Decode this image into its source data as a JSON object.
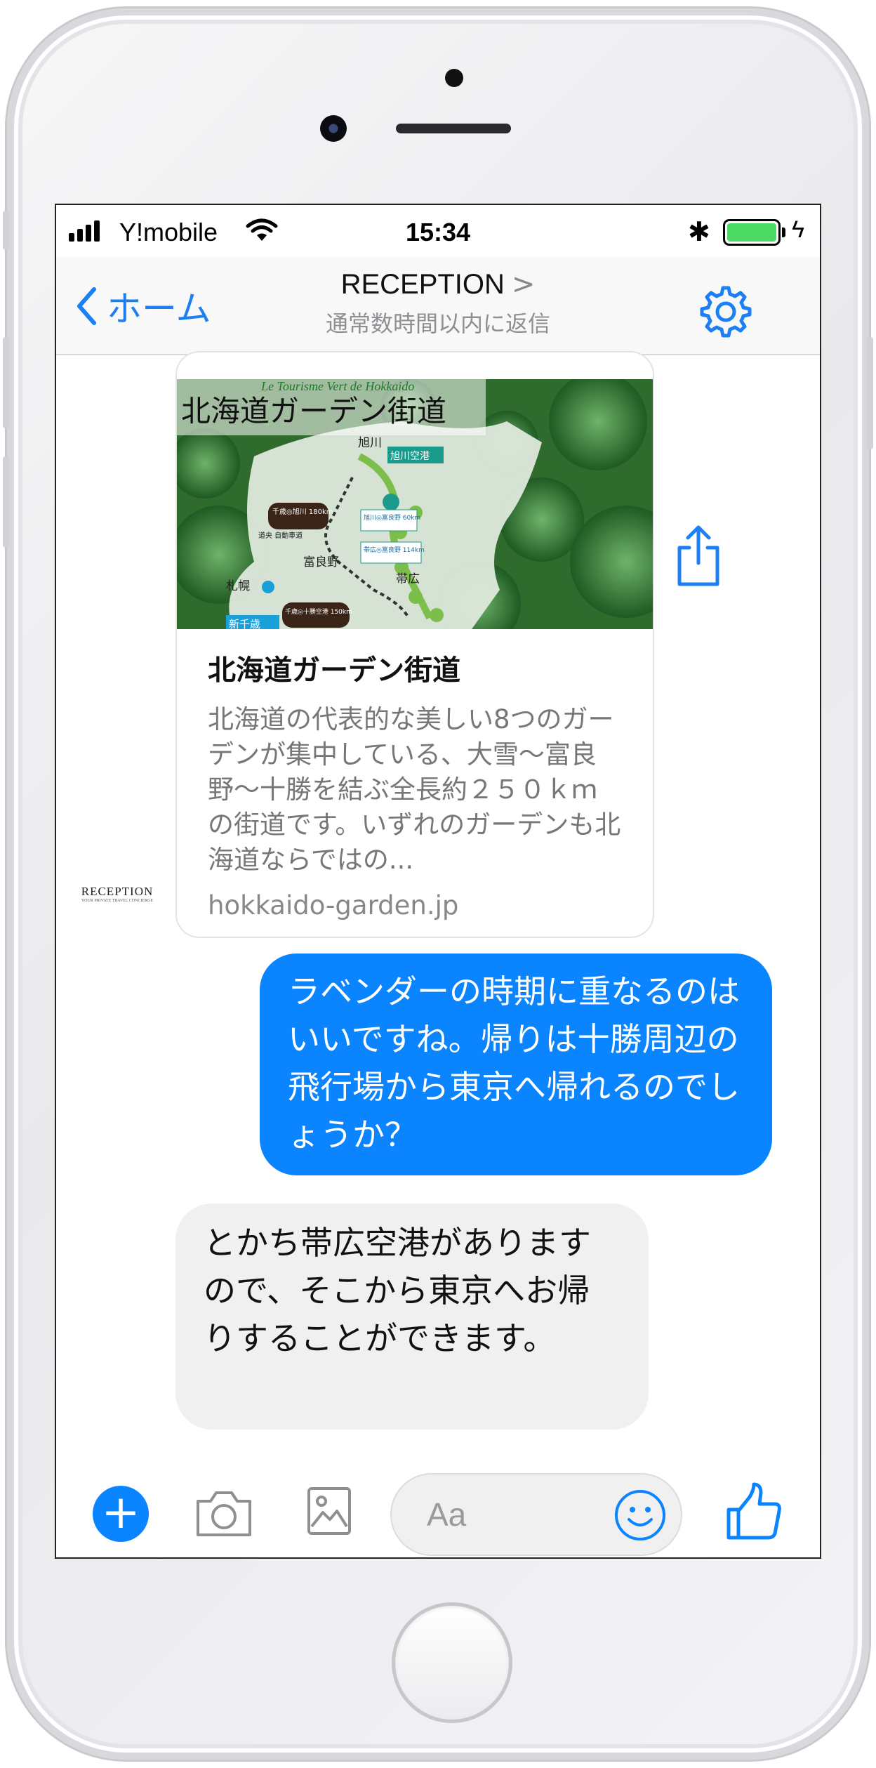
{
  "status": {
    "carrier": "Y!mobile",
    "time": "15:34",
    "bluetooth": "bluetooth-icon",
    "battery_level": 1.0
  },
  "nav": {
    "back_label": "ホーム",
    "title": "RECEPTION",
    "chevron": ">",
    "subtitle": "通常数時間以内に返信"
  },
  "link_preview": {
    "image_title": "北海道ガーデン街道",
    "image_tagline": "Le Tourisme Vert de Hokkaido",
    "map_labels": [
      "旭川",
      "旭川空港",
      "千歳◎旭川 180km",
      "道央 自動車道",
      "札幌",
      "富良野",
      "帯広",
      "新千歳",
      "千歳◎十勝空港 150km",
      "帯広◎富良野 114km",
      "旭川◎富良野 60km"
    ],
    "title": "北海道ガーデン街道",
    "description": "北海道の代表的な美しい8つのガーデンが集中している、大雪〜富良野〜十勝を結ぶ全長約２５０ｋｍの街道です。いずれのガーデンも北海道ならではの...",
    "domain": "hokkaido-garden.jp"
  },
  "sender_logo": {
    "name": "RECEPTION",
    "tagline": "YOUR PRIVATE TRAVEL CONCIERGE"
  },
  "messages": {
    "outgoing": "ラベンダーの時期に重なるのはいいですね。帰りは十勝周辺の飛行場から東京へ帰れるのでしょうか？",
    "incoming": "とかち帯広空港がありますので、そこから東京へお帰りすることができます。"
  },
  "composer": {
    "placeholder": "Aa"
  },
  "colors": {
    "accent": "#0a84ff",
    "link": "#1c7ff4",
    "incoming_bubble": "#f0f0f0",
    "battery": "#4cd964"
  }
}
